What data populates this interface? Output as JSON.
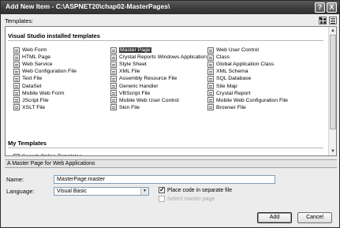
{
  "window": {
    "title": "Add New Item - C:\\ASPNET20\\chap02-MasterPages\\"
  },
  "titlebar_buttons": {
    "help": "?",
    "close": "X"
  },
  "templates_label": "Templates:",
  "sections": {
    "installed": "Visual Studio installed templates",
    "my": "My Templates"
  },
  "installed_items": [
    {
      "label": "Web Form",
      "icon": "web-form-icon"
    },
    {
      "label": "Master Page",
      "icon": "master-page-icon",
      "selected": true
    },
    {
      "label": "Web User Control",
      "icon": "web-user-control-icon"
    },
    {
      "label": "HTML Page",
      "icon": "html-page-icon"
    },
    {
      "label": "Crystal Reports Windows Application",
      "icon": "crystal-reports-icon"
    },
    {
      "label": "Class",
      "icon": "class-icon"
    },
    {
      "label": "Web Service",
      "icon": "web-service-icon"
    },
    {
      "label": "Style Sheet",
      "icon": "style-sheet-icon"
    },
    {
      "label": "Global Application Class",
      "icon": "global-application-class-icon"
    },
    {
      "label": "Web Configuration File",
      "icon": "web-config-icon"
    },
    {
      "label": "XML File",
      "icon": "xml-file-icon"
    },
    {
      "label": "XML Schema",
      "icon": "xml-schema-icon"
    },
    {
      "label": "Text File",
      "icon": "text-file-icon"
    },
    {
      "label": "Assembly Resource File",
      "icon": "assembly-resource-icon"
    },
    {
      "label": "SQL Database",
      "icon": "sql-database-icon"
    },
    {
      "label": "DataSet",
      "icon": "dataset-icon"
    },
    {
      "label": "Generic Handler",
      "icon": "generic-handler-icon"
    },
    {
      "label": "Site Map",
      "icon": "site-map-icon"
    },
    {
      "label": "Mobile Web Form",
      "icon": "mobile-web-form-icon"
    },
    {
      "label": "VBScript File",
      "icon": "vbscript-file-icon"
    },
    {
      "label": "Crystal Report",
      "icon": "crystal-report-icon"
    },
    {
      "label": "JScript File",
      "icon": "jscript-file-icon"
    },
    {
      "label": "Mobile Web User Control",
      "icon": "mobile-web-user-control-icon"
    },
    {
      "label": "Mobile Web Configuration File",
      "icon": "mobile-web-config-icon"
    },
    {
      "label": "XSLT File",
      "icon": "xslt-file-icon"
    },
    {
      "label": "Skin File",
      "icon": "skin-file-icon"
    },
    {
      "label": "Browser File",
      "icon": "browser-file-icon"
    }
  ],
  "my_items": [
    {
      "label": "Search Online Templates...",
      "icon": "search-online-templates-icon"
    }
  ],
  "description": "A Master Page for Web Applications",
  "form": {
    "name_label": "Name:",
    "name_value": "MasterPage.master",
    "language_label": "Language:",
    "language_value": "Visual Basic",
    "place_code_label": "Place code in separate file",
    "place_code_checked": true,
    "select_master_label": "Select master page",
    "select_master_checked": false
  },
  "buttons": {
    "add": "Add",
    "cancel": "Cancel"
  }
}
